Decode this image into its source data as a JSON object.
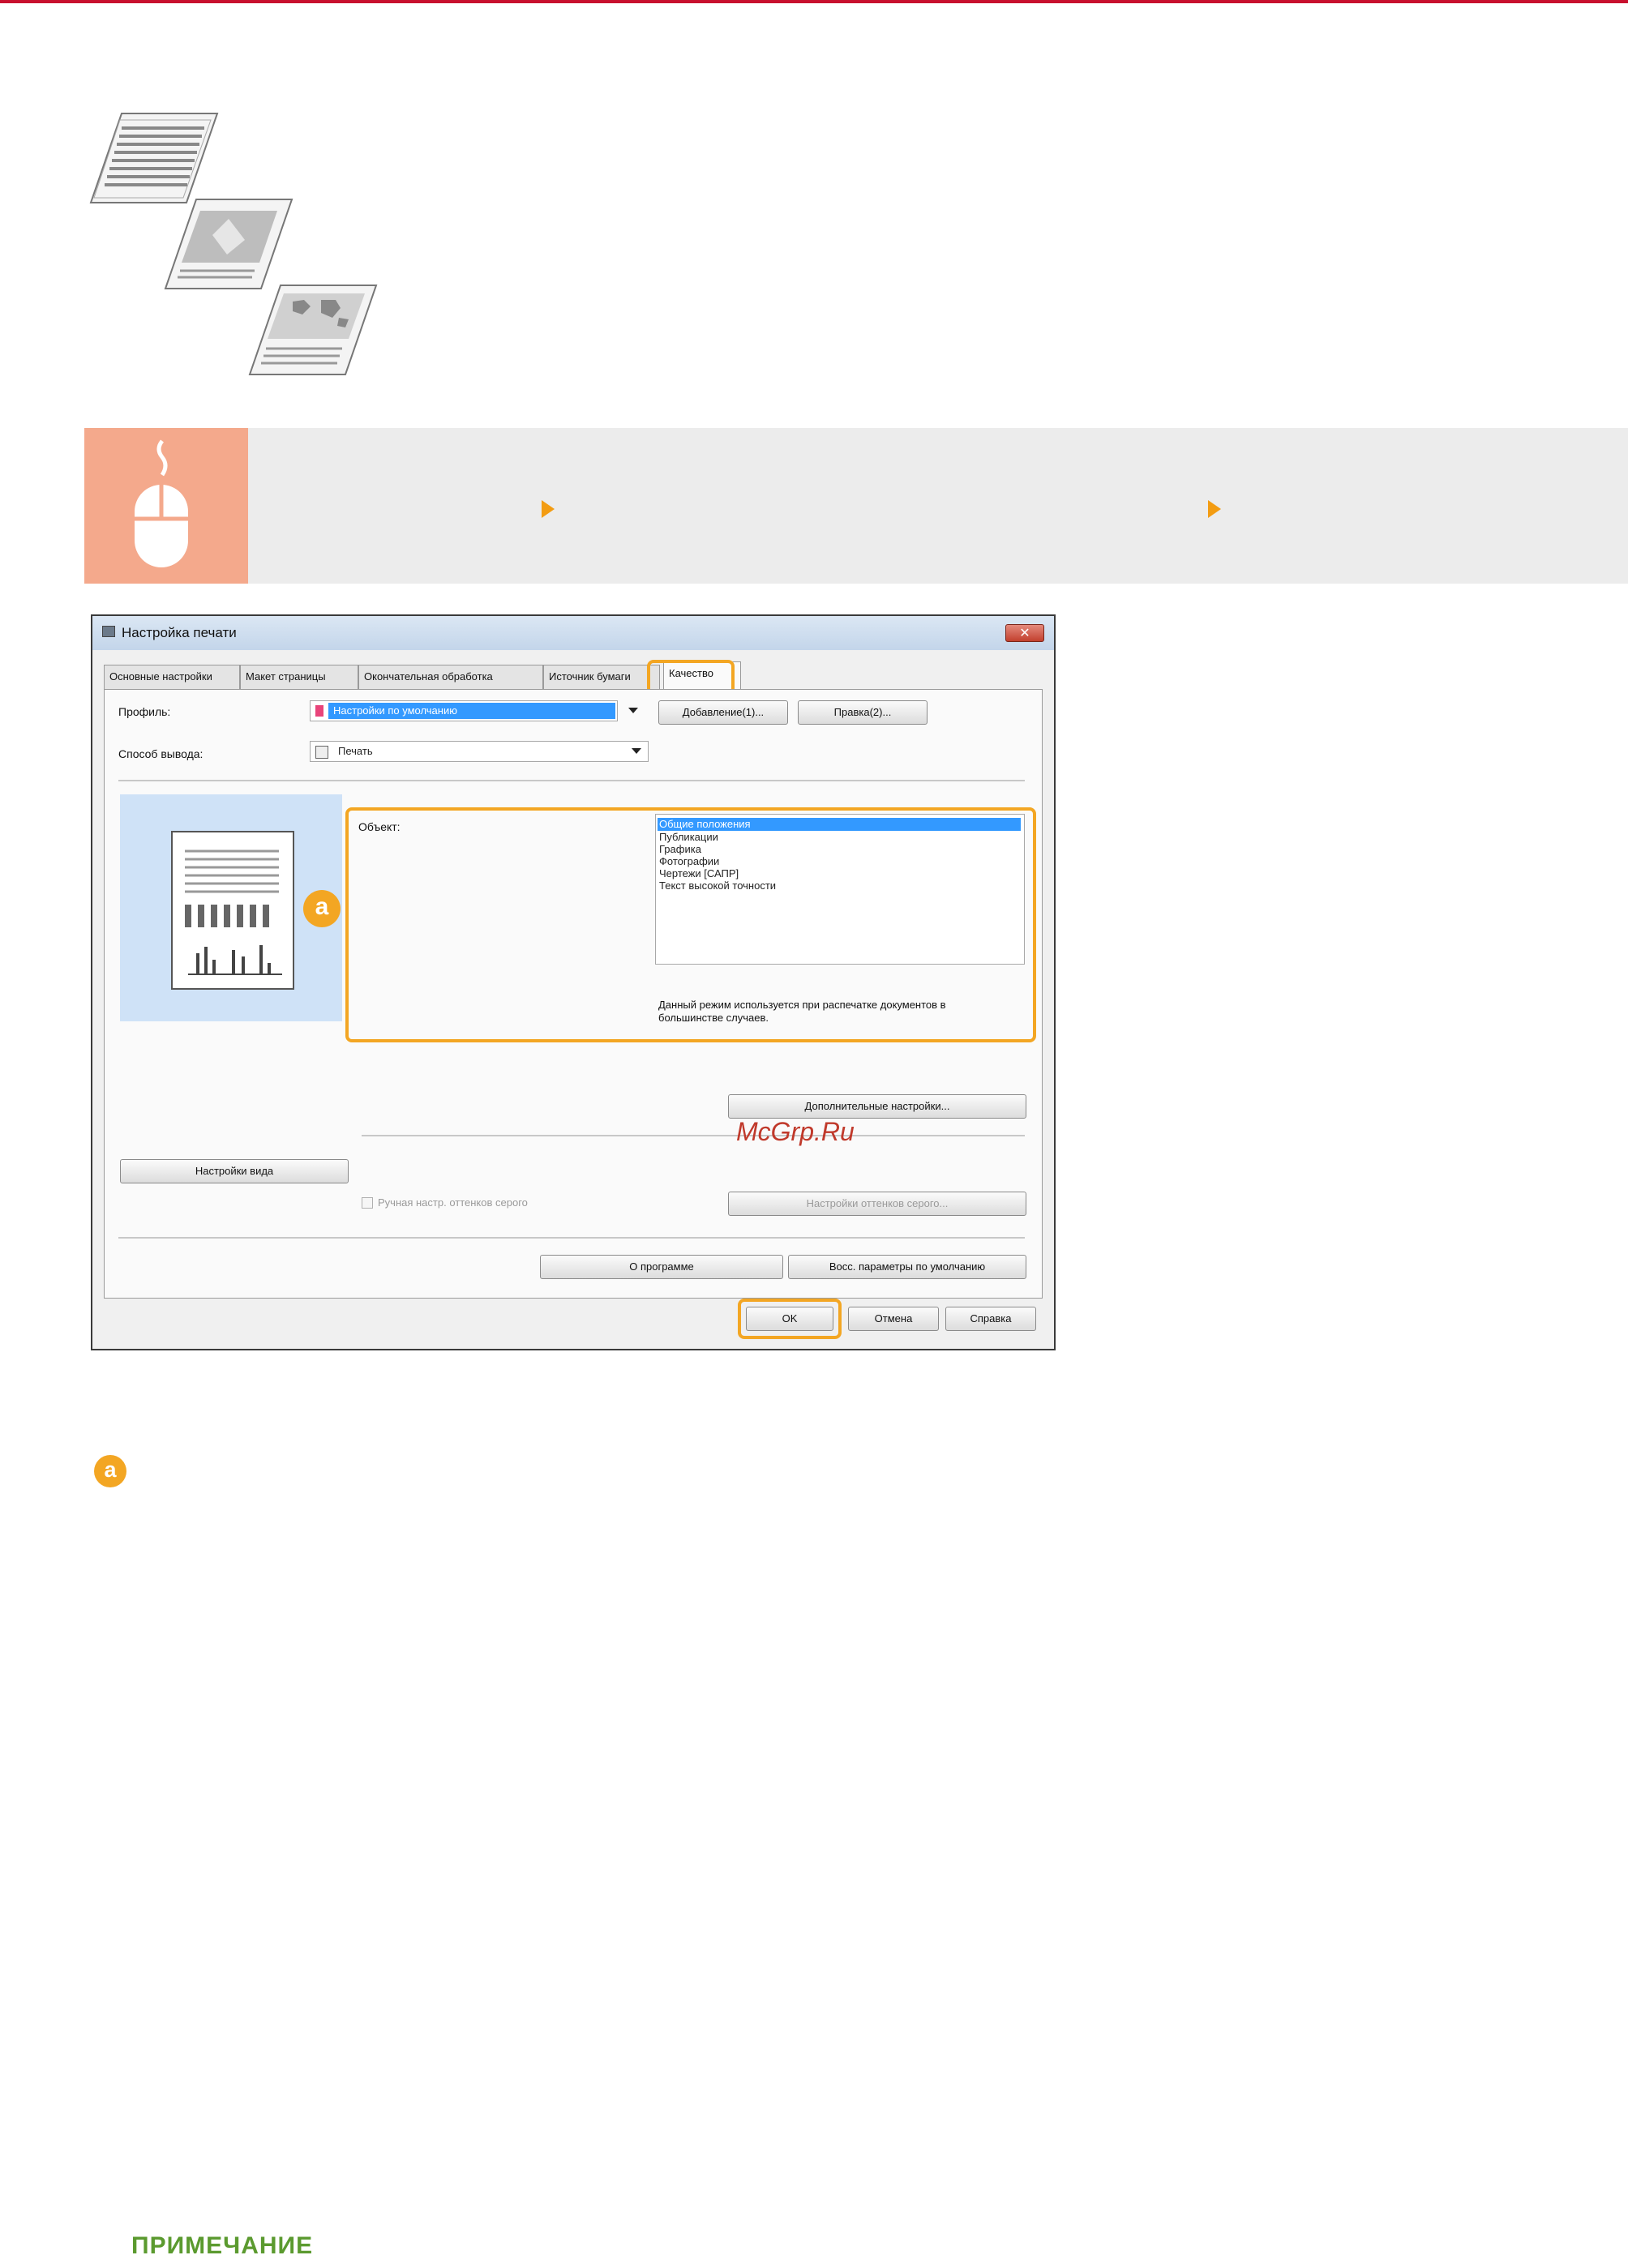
{
  "dialog": {
    "title": "Настройка печати",
    "close_label": "✕",
    "tabs": [
      "Основные настройки",
      "Макет страницы",
      "Окончательная обработка",
      "Источник бумаги",
      "Качество"
    ],
    "profile_label": "Профиль:",
    "profile_value": "Настройки по умолчанию",
    "add_button": "Добавление(1)...",
    "edit_button": "Правка(2)...",
    "output_label": "Способ вывода:",
    "output_value": "Печать",
    "object_label": "Объект:",
    "objects": [
      "Общие положения",
      "Публикации",
      "Графика",
      "Фотографии",
      "Чертежи [САПР]",
      "Текст высокой точности"
    ],
    "description": "Данный режим используется при распечатке документов в большинстве случаев.",
    "advanced_button": "Дополнительные настройки...",
    "view_settings_button": "Настройки вида",
    "manual_gray_label": "Ручная настр. оттенков серого",
    "gray_settings_button": "Настройки оттенков серого...",
    "about_button": "О программе",
    "restore_button": "Восс. параметры по умолчанию",
    "ok_button": "OK",
    "cancel_button": "Отмена",
    "help_button": "Справка",
    "callout_marker": "a"
  },
  "watermark": "McGrp.Ru",
  "callout_marker": "a",
  "note_heading": "ПРИМЕЧАНИЕ",
  "colors": {
    "accent": "#f3a623",
    "top_rule": "#c8102e",
    "instruction_icon_bg": "#f4a98c",
    "note_green": "#5b9a2f"
  }
}
